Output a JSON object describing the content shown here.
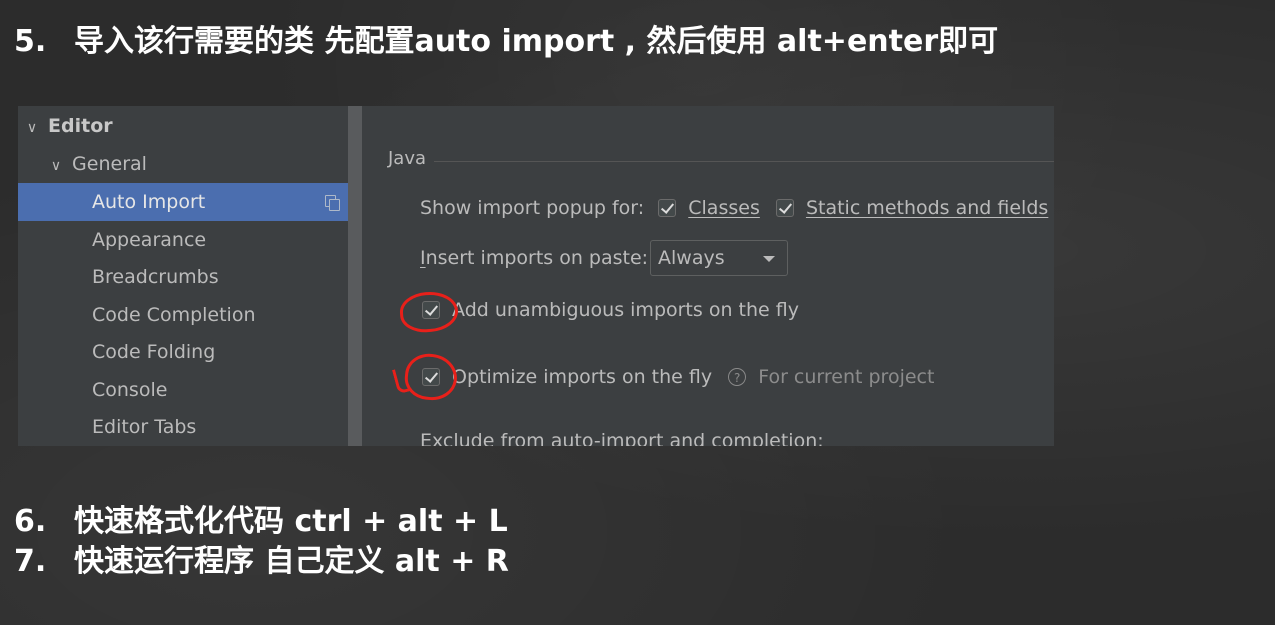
{
  "slide": {
    "item5_num": "5.",
    "item5_text": "导入该行需要的类 先配置auto import , 然后使用 alt+enter即可",
    "item6_num": "6.",
    "item6_text": "快速格式化代码 ctrl + alt + L",
    "item7_num": "7.",
    "item7_text": "快速运行程序 自己定义 alt + R"
  },
  "sidebar": {
    "editor": "Editor",
    "general": "General",
    "items": [
      {
        "label": "Auto Import",
        "selected": true
      },
      {
        "label": "Appearance"
      },
      {
        "label": "Breadcrumbs"
      },
      {
        "label": "Code Completion"
      },
      {
        "label": "Code Folding"
      },
      {
        "label": "Console"
      },
      {
        "label": "Editor Tabs"
      }
    ]
  },
  "panel": {
    "section": "Java",
    "popup_label": "Show import popup for:",
    "classes_label": "Classes",
    "static_label": "Static methods and fields",
    "paste_label_u": "I",
    "paste_label_rest": "nsert imports on paste:",
    "paste_value": "Always",
    "unambiguous_label": "Add unambiguous imports on the fly",
    "optimize_label": "Optimize imports on the fly",
    "optimize_hint": "For current project",
    "exclude_label": "Exclude from auto-import and completion:"
  },
  "colors": {
    "selection": "#4b6eaf",
    "annotation_red": "#e8201a",
    "panel_bg": "#3c3f41"
  },
  "icons": {
    "expand": "chevron-down-icon",
    "settings_copy": "copy-icon",
    "help": "question-circle-icon"
  }
}
